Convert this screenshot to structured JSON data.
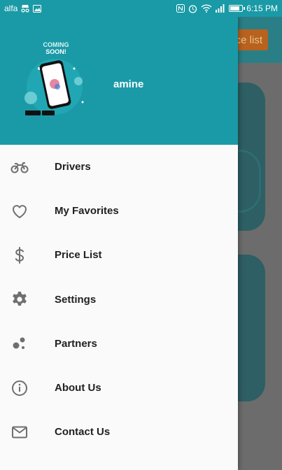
{
  "status_bar": {
    "carrier": "alfa",
    "time": "6:15 PM",
    "left_icons": [
      "alfa-logo-icon",
      "incognito-icon",
      "gallery-icon"
    ],
    "right_icons": [
      "nfc-icon",
      "alarm-icon",
      "wifi-icon",
      "signal-icon",
      "battery-icon"
    ]
  },
  "background": {
    "button_label": "ce list"
  },
  "drawer": {
    "username": "amine",
    "promo": {
      "line1": "COMING",
      "line2": "SOON!"
    },
    "items": [
      {
        "label": "Drivers",
        "icon": "motorcycle-icon"
      },
      {
        "label": "My Favorites",
        "icon": "heart-icon"
      },
      {
        "label": "Price List",
        "icon": "dollar-icon"
      },
      {
        "label": "Settings",
        "icon": "gear-icon"
      },
      {
        "label": "Partners",
        "icon": "bubbles-icon"
      },
      {
        "label": "About Us",
        "icon": "info-icon"
      },
      {
        "label": "Contact Us",
        "icon": "mail-icon"
      }
    ]
  },
  "colors": {
    "primary": "#1a9aa6",
    "drawer_bg": "#fafafa",
    "icon_gray": "#6f6f6f",
    "accent": "#b8621e"
  }
}
